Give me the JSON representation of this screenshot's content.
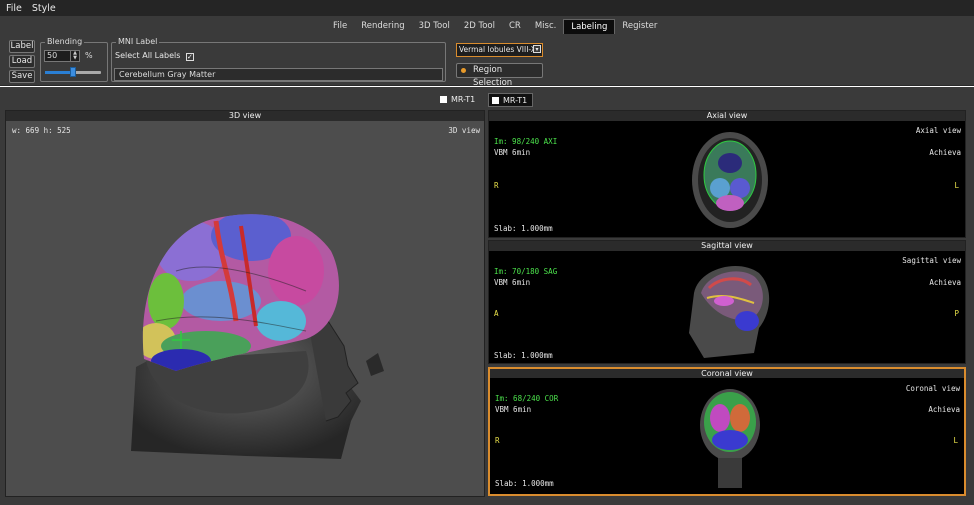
{
  "menubar": {
    "items": [
      "File",
      "Style"
    ]
  },
  "tabs": [
    "File",
    "Rendering",
    "3D Tool",
    "2D Tool",
    "CR",
    "Misc.",
    "Labeling",
    "Register"
  ],
  "active_tab": "Labeling",
  "toolbar": {
    "label_btn": "Label",
    "load_btn": "Load",
    "save_btn": "Save",
    "blending": {
      "title": "Blending",
      "value": "50",
      "unit": "%",
      "slider_fraction": 0.5
    },
    "mni": {
      "title": "MNI Label",
      "select_all": "Select All Labels",
      "checked_mark": "✓",
      "current_label": "Cerebellum Gray Matter"
    },
    "dropdown_value": "Vermal lobules VIII-X",
    "dropdown_arrow": "▾",
    "region_selection": "Region Selection"
  },
  "view_selector": {
    "left": "MR-T1",
    "right": "MR-T1"
  },
  "view3d": {
    "title": "3D view",
    "size": "w: 669 h: 525",
    "label": "3D view"
  },
  "axial": {
    "title": "Axial view",
    "im": "Im: 98/240 AXI",
    "seq": "VBM 6min",
    "name": "Axial view",
    "vendor": "Achieva",
    "left": "R",
    "right": "L",
    "slab": "Slab: 1.000mm"
  },
  "sagittal": {
    "title": "Sagittal view",
    "im": "Im: 70/180 SAG",
    "seq": "VBM 6min",
    "name": "Sagittal view",
    "vendor": "Achieva",
    "left": "A",
    "right": "P",
    "slab": "Slab: 1.000mm"
  },
  "coronal": {
    "title": "Coronal view",
    "im": "Im: 68/240 COR",
    "seq": "VBM 6min",
    "name": "Coronal view",
    "vendor": "Achieva",
    "left": "R",
    "right": "L",
    "slab": "Slab: 1.000mm"
  },
  "colors": {
    "accent": "#d98c2e",
    "slider": "#2a7fd4",
    "overlay_green": "#4ce34c",
    "orientation_yellow": "#e8e04a"
  }
}
